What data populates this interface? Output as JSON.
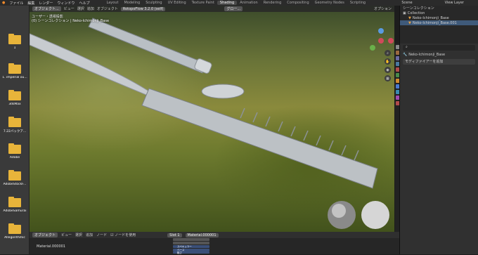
{
  "topbar": {
    "menus": [
      "ファイル",
      "編集",
      "レンダー",
      "ウィンドウ",
      "ヘルプ"
    ],
    "workspaces": [
      "Layout",
      "Modeling",
      "Sculpting",
      "UV Editing",
      "Texture Paint",
      "Shading",
      "Animation",
      "Rendering",
      "Compositing",
      "Geometry Nodes",
      "Scripting"
    ],
    "active_workspace": "Shading",
    "scene": "Scene",
    "view_layer": "View Layer"
  },
  "file_panel": {
    "items": [
      "1",
      "1. imperial ou...",
      "3dsMax",
      "7.22バックア...",
      "Adobe",
      "AdobeStockF...",
      "AdobeSamurai",
      "Allegorithmic"
    ]
  },
  "viewport": {
    "mode": "オブジェクト...",
    "menus": [
      "ビュー",
      "選択",
      "追加",
      "オブジェクト"
    ],
    "render_engine": "RotopoFlow 3.2.0 (self)",
    "transform": "グロー...",
    "overlay_line1": "ユーザー・透視投影",
    "overlay_line2": "(0) シーンコレクション | Neko-Ichimonji_Base",
    "options": "オプション"
  },
  "outliner": {
    "title": "シーンコレクション",
    "rows": [
      "Collection",
      "Neko-Ichimonji_Base",
      "Neko-Ichimonji_Base.001"
    ]
  },
  "properties": {
    "object_name": "Neko-Ichimonji_Base",
    "add_modifier": "モディファイアーを追加"
  },
  "node_editor": {
    "mode": "オブジェクト",
    "menus": [
      "ビュー",
      "選択",
      "追加",
      "ノード"
    ],
    "use_nodes": "ノードを使用",
    "slot": "Slot 1",
    "material": "Material.000001",
    "material_label": "Material.000001",
    "node_rows": [
      "",
      "",
      "スペキュラー",
      "ベース",
      "粗さ"
    ]
  },
  "colors": {
    "accent": "#4772b3",
    "folder": "#e8b43a"
  }
}
